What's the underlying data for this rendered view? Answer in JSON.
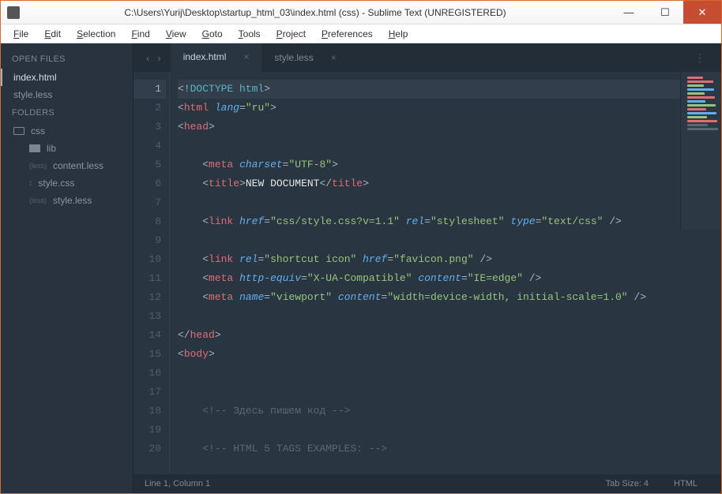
{
  "titlebar": {
    "title": "C:\\Users\\Yurij\\Desktop\\startup_html_03\\index.html (css) - Sublime Text (UNREGISTERED)"
  },
  "menubar": [
    "File",
    "Edit",
    "Selection",
    "Find",
    "View",
    "Goto",
    "Tools",
    "Project",
    "Preferences",
    "Help"
  ],
  "sidebar": {
    "open_files_label": "OPEN FILES",
    "open_files": [
      {
        "name": "index.html",
        "active": true
      },
      {
        "name": "style.less",
        "active": false
      }
    ],
    "folders_label": "FOLDERS",
    "tree": {
      "root": "css",
      "children": [
        {
          "name": "lib",
          "type": "folder"
        },
        {
          "name": "content.less",
          "type": "file",
          "badge": "(less)"
        },
        {
          "name": "style.css",
          "type": "file",
          "badge": "⟟"
        },
        {
          "name": "style.less",
          "type": "file",
          "badge": "(less)"
        }
      ]
    }
  },
  "tabs": [
    {
      "label": "index.html",
      "active": true
    },
    {
      "label": "style.less",
      "active": false
    }
  ],
  "status": {
    "position": "Line 1, Column 1",
    "tab_size": "Tab Size: 4",
    "syntax": "HTML"
  },
  "code": {
    "lines": [
      {
        "n": 1,
        "hl": true,
        "tokens": [
          {
            "c": "pn",
            "t": "<!"
          },
          {
            "c": "doc",
            "t": "DOCTYPE html"
          },
          {
            "c": "pn",
            "t": ">"
          }
        ]
      },
      {
        "n": 2,
        "tokens": [
          {
            "c": "pn",
            "t": "<"
          },
          {
            "c": "tg",
            "t": "html"
          },
          {
            "c": "",
            "t": " "
          },
          {
            "c": "at",
            "t": "lang"
          },
          {
            "c": "pn",
            "t": "="
          },
          {
            "c": "st",
            "t": "\"ru\""
          },
          {
            "c": "pn",
            "t": ">"
          }
        ]
      },
      {
        "n": 3,
        "tokens": [
          {
            "c": "pn",
            "t": "<"
          },
          {
            "c": "tg",
            "t": "head"
          },
          {
            "c": "pn",
            "t": ">"
          }
        ]
      },
      {
        "n": 4,
        "tokens": []
      },
      {
        "n": 5,
        "indent": 1,
        "tokens": [
          {
            "c": "pn",
            "t": "<"
          },
          {
            "c": "tg",
            "t": "meta"
          },
          {
            "c": "",
            "t": " "
          },
          {
            "c": "at",
            "t": "charset"
          },
          {
            "c": "pn",
            "t": "="
          },
          {
            "c": "st",
            "t": "\"UTF-8\""
          },
          {
            "c": "pn",
            "t": ">"
          }
        ]
      },
      {
        "n": 6,
        "indent": 1,
        "tokens": [
          {
            "c": "pn",
            "t": "<"
          },
          {
            "c": "tg",
            "t": "title"
          },
          {
            "c": "pn",
            "t": ">"
          },
          {
            "c": "txt",
            "t": "NEW DOCUMENT"
          },
          {
            "c": "pn",
            "t": "</"
          },
          {
            "c": "tg",
            "t": "title"
          },
          {
            "c": "pn",
            "t": ">"
          }
        ]
      },
      {
        "n": 7,
        "tokens": []
      },
      {
        "n": 8,
        "indent": 1,
        "tokens": [
          {
            "c": "pn",
            "t": "<"
          },
          {
            "c": "tg",
            "t": "link"
          },
          {
            "c": "",
            "t": " "
          },
          {
            "c": "at",
            "t": "href"
          },
          {
            "c": "pn",
            "t": "="
          },
          {
            "c": "st",
            "t": "\"css/style.css?v=1.1\""
          },
          {
            "c": "",
            "t": " "
          },
          {
            "c": "at",
            "t": "rel"
          },
          {
            "c": "pn",
            "t": "="
          },
          {
            "c": "st",
            "t": "\"stylesheet\""
          },
          {
            "c": "",
            "t": " "
          },
          {
            "c": "at",
            "t": "type"
          },
          {
            "c": "pn",
            "t": "="
          },
          {
            "c": "st",
            "t": "\"text/css\""
          },
          {
            "c": "pn",
            "t": " />"
          }
        ]
      },
      {
        "n": 9,
        "tokens": []
      },
      {
        "n": 10,
        "indent": 1,
        "tokens": [
          {
            "c": "pn",
            "t": "<"
          },
          {
            "c": "tg",
            "t": "link"
          },
          {
            "c": "",
            "t": " "
          },
          {
            "c": "at",
            "t": "rel"
          },
          {
            "c": "pn",
            "t": "="
          },
          {
            "c": "st",
            "t": "\"shortcut icon\""
          },
          {
            "c": "",
            "t": " "
          },
          {
            "c": "at",
            "t": "href"
          },
          {
            "c": "pn",
            "t": "="
          },
          {
            "c": "st",
            "t": "\"favicon.png\""
          },
          {
            "c": "pn",
            "t": " />"
          }
        ]
      },
      {
        "n": 11,
        "indent": 1,
        "tokens": [
          {
            "c": "pn",
            "t": "<"
          },
          {
            "c": "tg",
            "t": "meta"
          },
          {
            "c": "",
            "t": " "
          },
          {
            "c": "at",
            "t": "http-equiv"
          },
          {
            "c": "pn",
            "t": "="
          },
          {
            "c": "st",
            "t": "\"X-UA-Compatible\""
          },
          {
            "c": "",
            "t": " "
          },
          {
            "c": "at",
            "t": "content"
          },
          {
            "c": "pn",
            "t": "="
          },
          {
            "c": "st",
            "t": "\"IE=edge\""
          },
          {
            "c": "pn",
            "t": " />"
          }
        ]
      },
      {
        "n": 12,
        "indent": 1,
        "tokens": [
          {
            "c": "pn",
            "t": "<"
          },
          {
            "c": "tg",
            "t": "meta"
          },
          {
            "c": "",
            "t": " "
          },
          {
            "c": "at",
            "t": "name"
          },
          {
            "c": "pn",
            "t": "="
          },
          {
            "c": "st",
            "t": "\"viewport\""
          },
          {
            "c": "",
            "t": " "
          },
          {
            "c": "at",
            "t": "content"
          },
          {
            "c": "pn",
            "t": "="
          },
          {
            "c": "st",
            "t": "\"width=device-width, initial-scale=1.0\""
          },
          {
            "c": "pn",
            "t": " />"
          }
        ]
      },
      {
        "n": 13,
        "tokens": []
      },
      {
        "n": 14,
        "tokens": [
          {
            "c": "pn",
            "t": "</"
          },
          {
            "c": "tg",
            "t": "head"
          },
          {
            "c": "pn",
            "t": ">"
          }
        ]
      },
      {
        "n": 15,
        "tokens": [
          {
            "c": "pn",
            "t": "<"
          },
          {
            "c": "tg",
            "t": "body"
          },
          {
            "c": "pn",
            "t": ">"
          }
        ]
      },
      {
        "n": 16,
        "tokens": []
      },
      {
        "n": 17,
        "tokens": []
      },
      {
        "n": 18,
        "indent": 1,
        "tokens": [
          {
            "c": "cm",
            "t": "<!-- Здесь пишем код -->"
          }
        ]
      },
      {
        "n": 19,
        "tokens": []
      },
      {
        "n": 20,
        "indent": 1,
        "tokens": [
          {
            "c": "cm",
            "t": "<!-- HTML 5 TAGS EXAMPLES: -->"
          }
        ]
      }
    ]
  },
  "minimap_colors": [
    "#e06c75",
    "#e06c75",
    "#98c379",
    "#61afef",
    "#98c379",
    "#e06c75",
    "#61afef",
    "#98c379",
    "#e06c75",
    "#61afef",
    "#98c379",
    "#e06c75",
    "#5c6773",
    "#5c6773"
  ]
}
